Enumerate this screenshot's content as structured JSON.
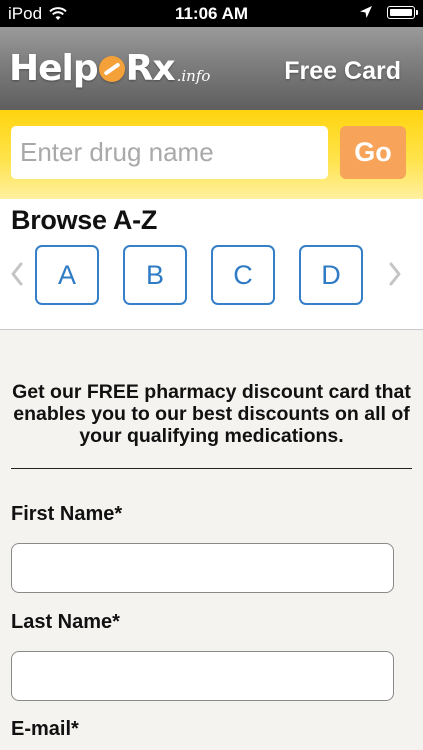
{
  "status_bar": {
    "carrier": "iPod",
    "time": "11:06 AM",
    "icons": [
      "wifi-icon",
      "location-arrow-icon",
      "battery-icon"
    ],
    "battery_level": 1.0
  },
  "header": {
    "logo": {
      "part1": "Help",
      "part2": "Rx",
      "suffix": ".info",
      "icon": "pill-icon"
    },
    "free_card_label": "Free Card"
  },
  "search": {
    "placeholder": "Enter drug name",
    "value": "",
    "go_label": "Go"
  },
  "browse": {
    "title": "Browse A-Z",
    "letters": [
      "A",
      "B",
      "C",
      "D"
    ],
    "icons": [
      "chevron-left-icon",
      "chevron-right-icon"
    ]
  },
  "form": {
    "promo": "Get our FREE pharmacy discount card that enables you to our best discounts on all of your qualifying medications.",
    "first_name_label": "First Name*",
    "first_name_value": "",
    "last_name_label": "Last Name*",
    "last_name_value": "",
    "email_label": "E-mail*"
  },
  "colors": {
    "header_gray": "#7d7d7d",
    "search_yellow": "#ffd40f",
    "go_orange": "#f7a35a",
    "letter_blue": "#3580c8",
    "logo_pill_orange": "#f5a13a",
    "page_background": "#f4f3f0"
  }
}
